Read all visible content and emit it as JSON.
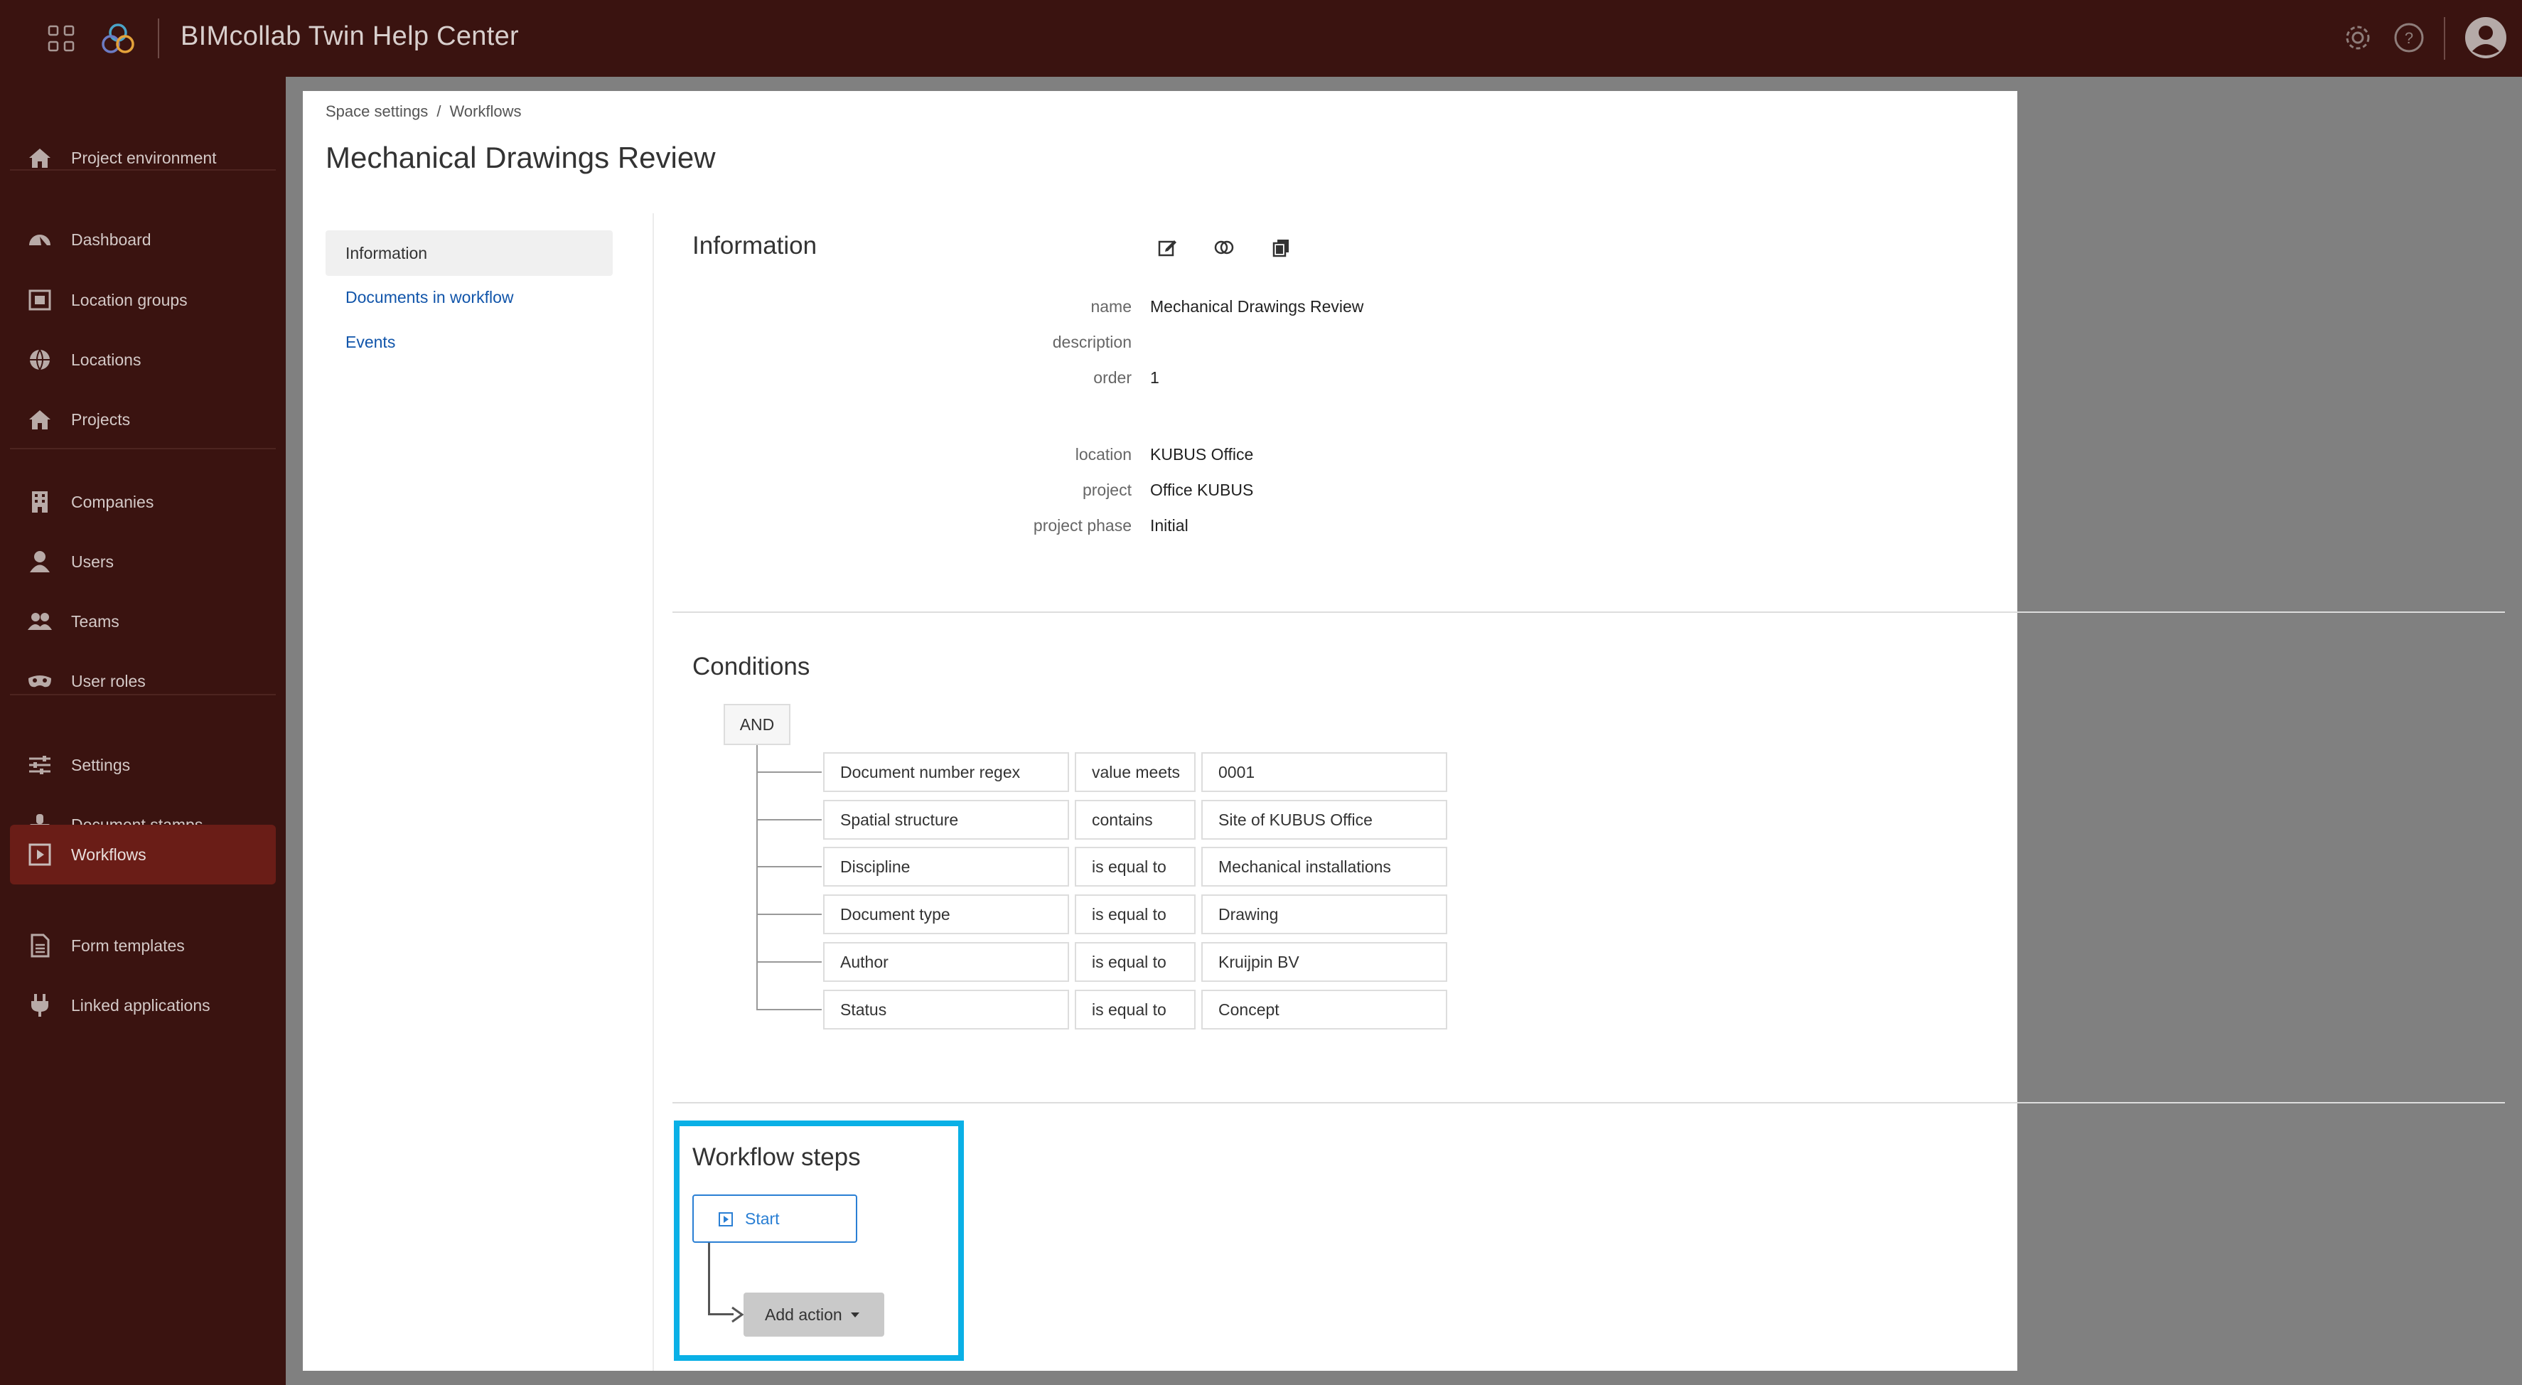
{
  "app": {
    "title": "BIMcollab Twin Help Center"
  },
  "sidebar": {
    "items": [
      {
        "label": "Project environment",
        "icon": "home-icon"
      },
      {
        "label": "Dashboard",
        "icon": "dashboard-icon"
      },
      {
        "label": "Location groups",
        "icon": "location-groups-icon"
      },
      {
        "label": "Locations",
        "icon": "globe-icon"
      },
      {
        "label": "Projects",
        "icon": "home-icon"
      },
      {
        "label": "Companies",
        "icon": "building-icon"
      },
      {
        "label": "Users",
        "icon": "user-icon"
      },
      {
        "label": "Teams",
        "icon": "users-icon"
      },
      {
        "label": "User roles",
        "icon": "mask-icon"
      },
      {
        "label": "Settings",
        "icon": "sliders-icon"
      },
      {
        "label": "Document stamps",
        "icon": "stamp-icon"
      },
      {
        "label": "Workflows",
        "icon": "workflow-icon"
      },
      {
        "label": "Form templates",
        "icon": "form-icon"
      },
      {
        "label": "Linked applications",
        "icon": "plug-icon"
      }
    ],
    "active": "Workflows"
  },
  "breadcrumb": {
    "parent": "Space settings",
    "separator": "/",
    "current": "Workflows"
  },
  "page": {
    "title": "Mechanical Drawings Review"
  },
  "subnav": {
    "items": [
      "Information",
      "Documents in workflow",
      "Events"
    ]
  },
  "information": {
    "title": "Information",
    "fields": [
      {
        "key": "name",
        "value": "Mechanical Drawings Review"
      },
      {
        "key": "description",
        "value": ""
      },
      {
        "key": "order",
        "value": "1"
      },
      {
        "key": "location",
        "value": "KUBUS Office"
      },
      {
        "key": "project",
        "value": "Office KUBUS"
      },
      {
        "key": "project phase",
        "value": "Initial"
      }
    ]
  },
  "conditions": {
    "title": "Conditions",
    "operator": "AND",
    "rows": [
      {
        "field": "Document number regex",
        "op": "value meets",
        "value": "0001"
      },
      {
        "field": "Spatial structure",
        "op": "contains",
        "value": "Site of KUBUS Office"
      },
      {
        "field": "Discipline",
        "op": "is equal to",
        "value": "Mechanical installations"
      },
      {
        "field": "Document type",
        "op": "is equal to",
        "value": "Drawing"
      },
      {
        "field": "Author",
        "op": "is equal to",
        "value": "Kruijpin BV"
      },
      {
        "field": "Status",
        "op": "is equal to",
        "value": "Concept"
      }
    ]
  },
  "workflow_steps": {
    "title": "Workflow steps",
    "start_label": "Start",
    "add_action_label": "Add action"
  },
  "colors": {
    "topbar": "#3a1310",
    "sidebar_active": "#6a1d17",
    "highlight": "#0ab0e6",
    "link": "#1155aa"
  }
}
